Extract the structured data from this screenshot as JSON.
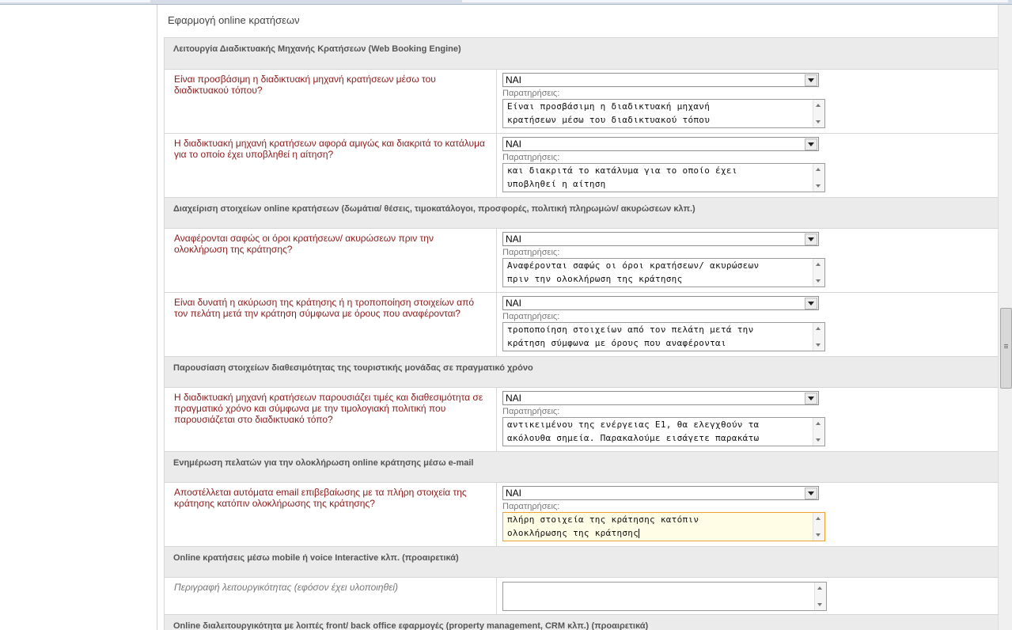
{
  "page": {
    "title": "Εφαρμογή online κρατήσεων"
  },
  "sections": [
    {
      "header": "Λειτουργία Διαδικτυακής Μηχανής Κρατήσεων (Web Booking Engine)",
      "questions": [
        {
          "text": "Είναι προσβάσιμη η διαδικτυακή μηχανή κρατήσεων μέσω του διαδικτυακού τόπου?",
          "answer": "ΝΑΙ",
          "notes_label": "Παρατηρήσεις:",
          "notes": "Είναι προσβάσιμη η διαδικτυακή μηχανή\nκρατήσεων μέσω του διαδικτυακού τόπου"
        },
        {
          "text": "Η διαδικτυακή μηχανή κρατήσεων αφορά αμιγώς και διακριτά το κατάλυμα για το οποίο έχει υποβληθεί η αίτηση?",
          "answer": "ΝΑΙ",
          "notes_label": "Παρατηρήσεις:",
          "notes": "και διακριτά το κατάλυμα για το οποίο έχει\nυποβληθεί η αίτηση"
        }
      ]
    },
    {
      "header": "Διαχείριση στοιχείων online κρατήσεων (δωμάτια/ θέσεις, τιμοκατάλογοι, προσφορές, πολιτική πληρωμών/ ακυρώσεων κλπ.)",
      "questions": [
        {
          "text": "Αναφέρονται σαφώς οι όροι κρατήσεων/ ακυρώσεων πριν την ολοκλήρωση της κράτησης?",
          "answer": "ΝΑΙ",
          "notes_label": "Παρατηρήσεις:",
          "notes": "Αναφέρονται σαφώς οι όροι κρατήσεων/ ακυρώσεων\nπριν την ολοκλήρωση της κράτησης"
        },
        {
          "text": "Είναι δυνατή η ακύρωση της κράτησης ή η τροποποίηση στοιχείων από τον πελάτη μετά την κράτηση σύμφωνα με όρους που αναφέρονται?",
          "answer": "ΝΑΙ",
          "notes_label": "Παρατηρήσεις:",
          "notes": "τροποποίηση στοιχείων από τον πελάτη μετά την\nκράτηση σύμφωνα με όρους που αναφέρονται"
        }
      ]
    },
    {
      "header": "Παρουσίαση στοιχείων διαθεσιμότητας της τουριστικής μονάδας σε πραγματικό χρόνο",
      "questions": [
        {
          "text": "Η διαδικτυακή μηχανή κρατήσεων παρουσιάζει τιμές και διαθεσιμότητα σε πραγματικό χρόνο και σύμφωνα με την τιμολογιακή πολιτική που παρουσιάζεται στο διαδικτυακό τόπο?",
          "answer": "ΝΑΙ",
          "notes_label": "Παρατηρήσεις:",
          "notes": "αντικειμένου της ενέργειας Ε1, θα ελεγχθούν τα\nακόλουθα σημεία. Παρακαλούμε εισάγετε παρακάτω"
        }
      ]
    },
    {
      "header": "Ενημέρωση πελατών για την ολοκλήρωση online κράτησης μέσω e-mail",
      "questions": [
        {
          "text": "Αποστέλλεται αυτόματα email επιβεβαίωσης με τα πλήρη στοιχεία της κράτησης κατόπιν ολοκλήρωσης της κράτησης?",
          "answer": "ΝΑΙ",
          "notes_label": "Παρατηρήσεις:",
          "notes": "πλήρη στοιχεία της κράτησης κατόπιν\nολοκλήρωσης της κράτησης"
        }
      ]
    },
    {
      "header": "Online κρατήσεις μέσω mobile ή voice Interactive κλπ. (προαιρετικά)",
      "optional": {
        "text": "Περιγραφή λειτουργικότητας (εφόσον έχει υλοποιηθεί)",
        "value": ""
      }
    },
    {
      "header": "Online διαλειτουργικότητα με λοιπές front/ back office εφαρμογές (property management, CRM κλπ.) (προαιρετικά)"
    }
  ]
}
